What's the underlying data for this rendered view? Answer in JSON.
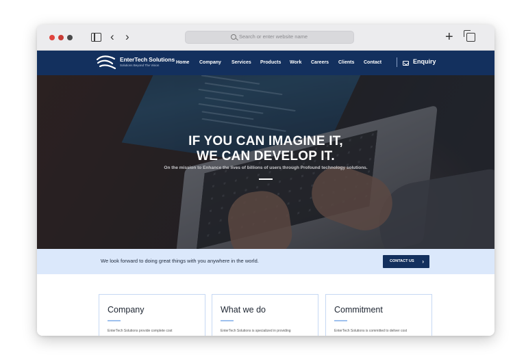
{
  "browser": {
    "address_placeholder": "Search or enter website name",
    "back_glyph": "‹",
    "forward_glyph": "›",
    "new_tab_glyph": "+"
  },
  "header": {
    "logo_title": "EnterTech Solutions",
    "logo_tagline": "Solutions Beyond The Vision",
    "nav": [
      "Home",
      "Company",
      "Services",
      "Products",
      "Work",
      "Careers",
      "Clients",
      "Contact"
    ],
    "enquiry": "Enquiry"
  },
  "hero": {
    "title_line1": "IF YOU CAN IMAGINE IT,",
    "title_line2": "WE CAN DEVELOP IT.",
    "subtitle": "On the mission to Enhance the lives of billions of users through Profound technology solutions."
  },
  "banner": {
    "text": "We look forward to doing great things with you anywhere in the world.",
    "button_label": "CONTACT US",
    "button_chevron": "›"
  },
  "cards": [
    {
      "title": "Company",
      "text": "EnterTech Solutions provide complete cost"
    },
    {
      "title": "What we do",
      "text": "EnterTech Solutions is specialized in providing"
    },
    {
      "title": "Commitment",
      "text": "EnterTech Solutions is committed to deliver cost"
    }
  ],
  "colors": {
    "header_bg": "#13305e",
    "banner_bg": "#dbe8fb",
    "card_border": "#c6d8f3",
    "accent_rule": "#9ec0ee"
  }
}
